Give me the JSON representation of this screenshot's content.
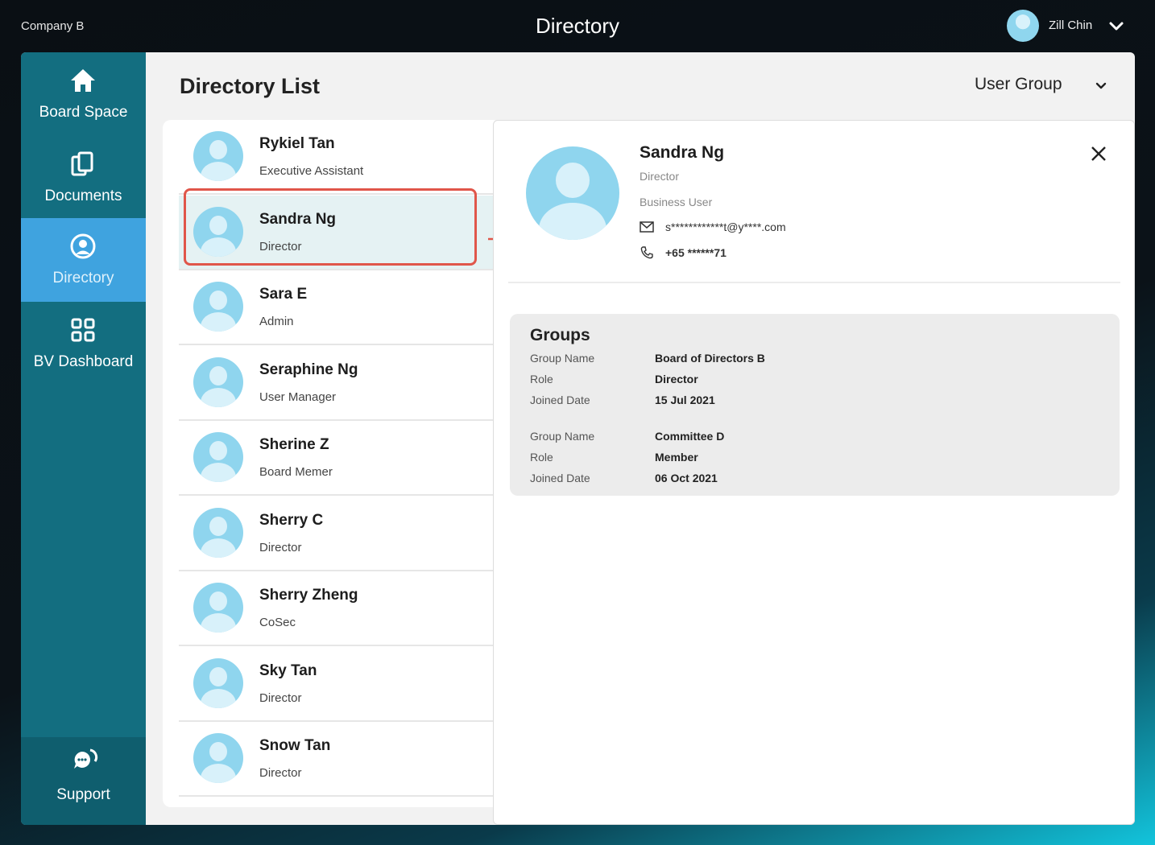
{
  "header": {
    "company": "Company B",
    "title": "Directory",
    "user_name": "Zill Chin"
  },
  "sidebar": {
    "items": [
      {
        "label": "Board Space",
        "icon": "home-icon"
      },
      {
        "label": "Documents",
        "icon": "documents-icon"
      },
      {
        "label": "Directory",
        "icon": "user-circle-icon",
        "active": true
      },
      {
        "label": "BV Dashboard",
        "icon": "grid-icon"
      }
    ],
    "support": {
      "label": "Support",
      "icon": "chat-icon"
    }
  },
  "list": {
    "heading": "Directory List",
    "filter_label": "User Group",
    "rows": [
      {
        "name": "Rykiel Tan",
        "role": "Executive Assistant"
      },
      {
        "name": "Sandra Ng",
        "role": "Director",
        "selected": true
      },
      {
        "name": "Sara E",
        "role": "Admin"
      },
      {
        "name": "Seraphine Ng",
        "role": "User Manager"
      },
      {
        "name": "Sherine Z",
        "role": "Board Memer"
      },
      {
        "name": "Sherry C",
        "role": "Director"
      },
      {
        "name": "Sherry Zheng",
        "role": "CoSec"
      },
      {
        "name": "Sky Tan",
        "role": "Director"
      },
      {
        "name": "Snow Tan",
        "role": "Director"
      }
    ]
  },
  "detail": {
    "name": "Sandra Ng",
    "role": "Director",
    "user_type": "Business User",
    "email": "s************t@y****.com",
    "phone": "+65 ******71",
    "groups_title": "Groups",
    "groups": [
      {
        "name_label": "Group Name",
        "name": "Board of Directors B",
        "role_label": "Role",
        "role": "Director",
        "date_label": "Joined Date",
        "date": "15 Jul 2021"
      },
      {
        "name_label": "Group Name",
        "name": "Committee D",
        "role_label": "Role",
        "role": "Member",
        "date_label": "Joined Date",
        "date": "06 Oct 2021"
      }
    ]
  },
  "colors": {
    "sidebar": "#136e80",
    "sidebar_active": "#3fa3df",
    "highlight": "#e0564a",
    "avatar": "#8fd5ee"
  }
}
